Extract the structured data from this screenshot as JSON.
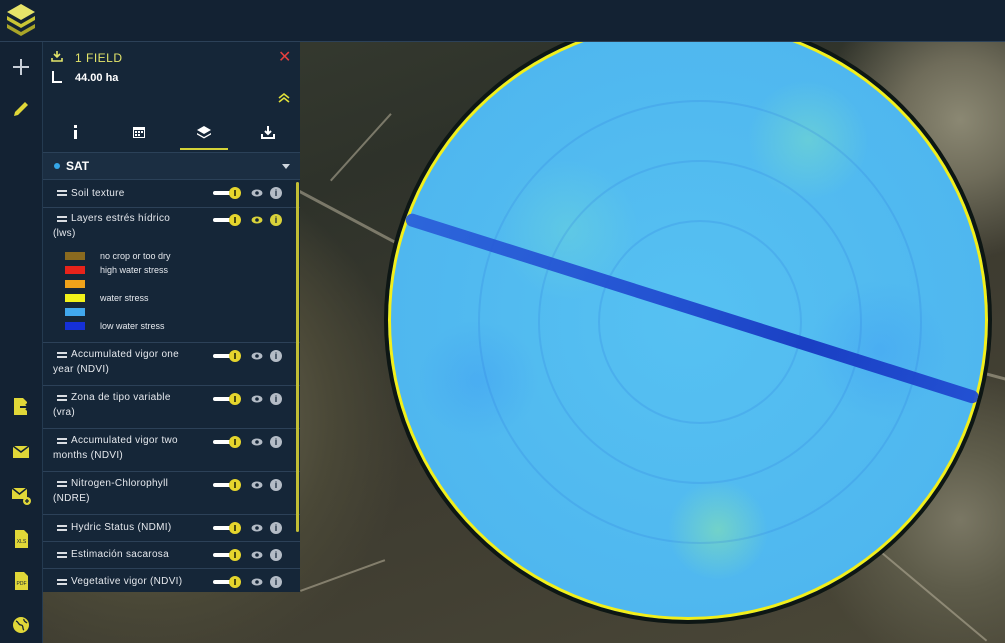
{
  "field": {
    "title": "1 FIELD",
    "area": "44.00 ha",
    "close_icon": "close-icon",
    "collapse_icon": "double-chevron-up-icon"
  },
  "tabs": [
    {
      "icon": "info-icon",
      "active": false
    },
    {
      "icon": "calendar-icon",
      "active": false
    },
    {
      "icon": "layers-icon",
      "active": true
    },
    {
      "icon": "download-icon",
      "active": false
    }
  ],
  "source": {
    "label": "SAT"
  },
  "layers": [
    {
      "name": "Soil texture",
      "line2": "",
      "enabled": true
    },
    {
      "name": "Layers estrés hídrico",
      "line2": "(lws)",
      "enabled": true,
      "info_active": true
    },
    {
      "name": "Accumulated vigor one",
      "line2": "year (NDVI)",
      "enabled": true
    },
    {
      "name": "Zona de tipo variable",
      "line2": "(vra)",
      "enabled": true
    },
    {
      "name": "Accumulated vigor two",
      "line2": "months (NDVI)",
      "enabled": true
    },
    {
      "name": "Nitrogen-Chlorophyll",
      "line2": "(NDRE)",
      "enabled": true
    },
    {
      "name": "Hydric Status (NDMI)",
      "line2": "",
      "enabled": true
    },
    {
      "name": "Estimación sacarosa",
      "line2": "",
      "enabled": true
    },
    {
      "name": "Vegetative vigor (NDVI)",
      "line2": "",
      "enabled": true
    }
  ],
  "legend": [
    {
      "color": "#8a6a1f",
      "label": "no crop or too dry"
    },
    {
      "color": "#e8231a",
      "label": "high water stress"
    },
    {
      "color": "#f0a21a",
      "label": ""
    },
    {
      "color": "#f2f21a",
      "label": "water stress"
    },
    {
      "color": "#41a8ee",
      "label": ""
    },
    {
      "color": "#1530d8",
      "label": "low water stress"
    }
  ],
  "rail": [
    "plus-icon",
    "pencil-icon",
    "export-file-icon",
    "mail-icon",
    "add-mail-icon",
    "xls-file-icon",
    "pdf-file-icon",
    "globe-icon"
  ],
  "colors": {
    "accent": "#d9d23a",
    "panel": "#152638",
    "close": "#e2403e"
  }
}
